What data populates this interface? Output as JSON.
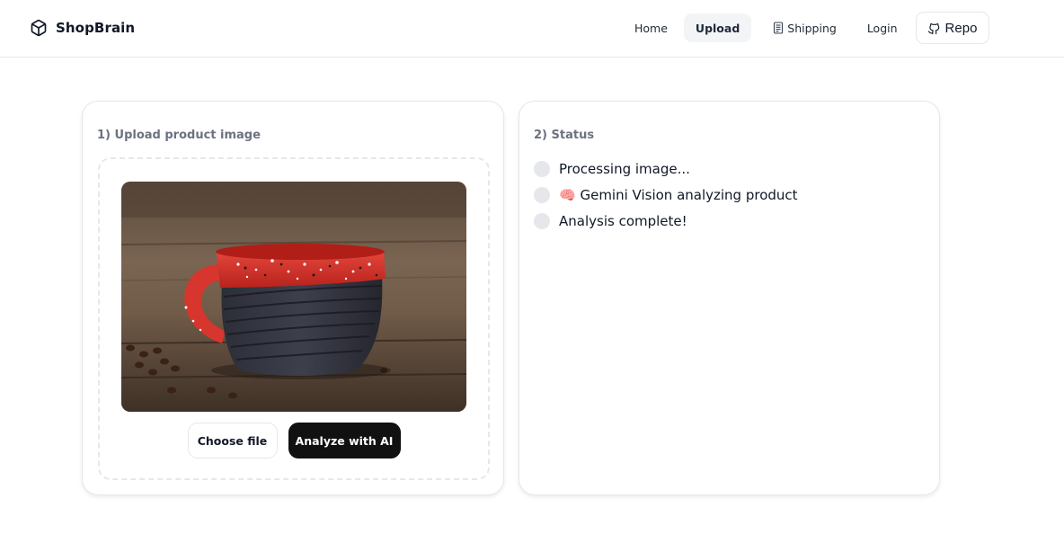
{
  "header": {
    "brand": "ShopBrain",
    "brand_icon": "cube-icon",
    "nav": {
      "home": "Home",
      "upload": "Upload",
      "shipping": "Shipping",
      "shipping_icon": "receipt-icon",
      "login": "Login",
      "repo": "Repo",
      "repo_icon": "github-icon",
      "active": "Upload"
    }
  },
  "upload_card": {
    "title": "1) Upload product image",
    "preview_description": "red speckled ceramic mug with textured dark base on wooden table with coffee beans",
    "choose_file_label": "Choose file",
    "analyze_label": "Analyze with AI"
  },
  "status_card": {
    "title": "2) Status",
    "steps": [
      {
        "emoji": "",
        "label": "Processing image..."
      },
      {
        "emoji": "🧠",
        "label": "Gemini Vision analyzing product"
      },
      {
        "emoji": "",
        "label": "Analysis complete!"
      }
    ]
  },
  "colors": {
    "primary_button": "#111111",
    "pending_dot": "#e5e7eb",
    "muted_text": "#6b7280",
    "border": "#e5e7eb"
  }
}
